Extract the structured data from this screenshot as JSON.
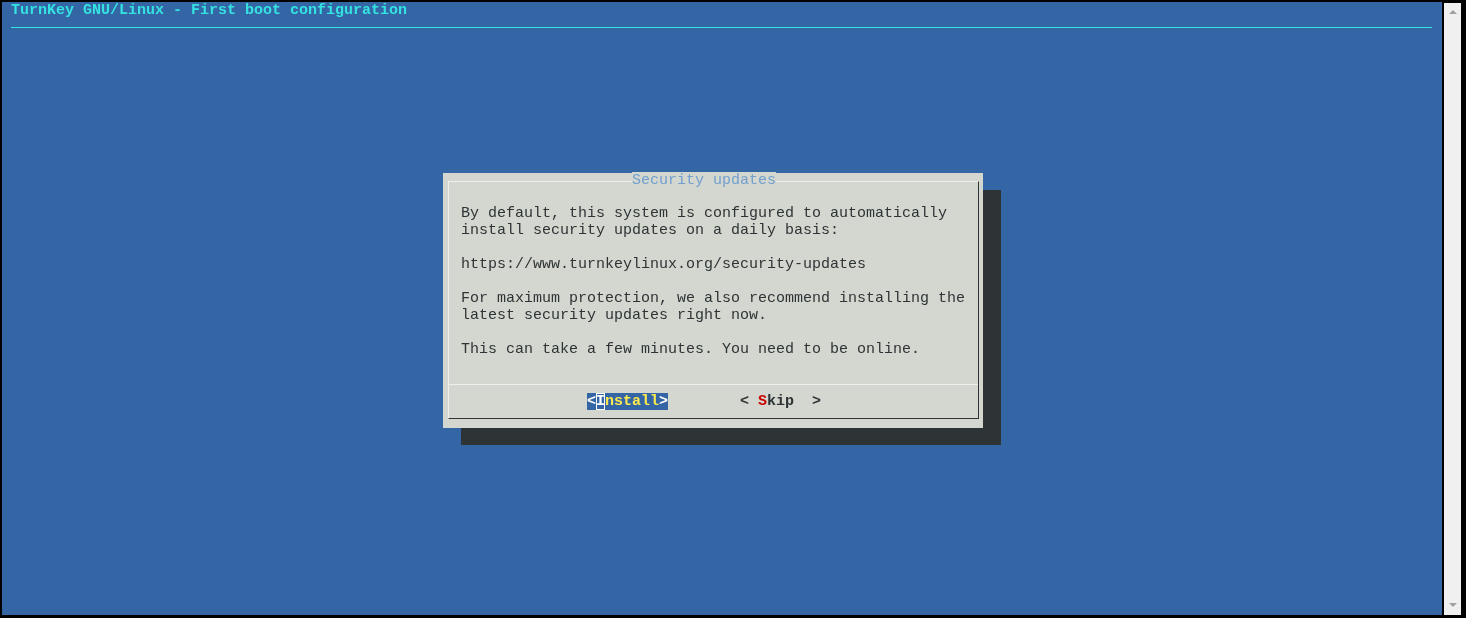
{
  "backtitle": "TurnKey GNU/Linux - First boot configuration",
  "dialog": {
    "title": "Security updates",
    "paragraphs": [
      "By default, this system is configured to automatically install security updates on a daily basis:",
      "https://www.turnkeylinux.org/security-updates",
      "For maximum protection, we also recommend installing the latest security updates right now.",
      "This can take a few minutes. You need to be online."
    ],
    "buttons": [
      {
        "left": "<",
        "label": "Install",
        "right": ">",
        "selected": true
      },
      {
        "left": "<",
        "label": "Skip",
        "right": ">",
        "selected": false
      }
    ]
  }
}
